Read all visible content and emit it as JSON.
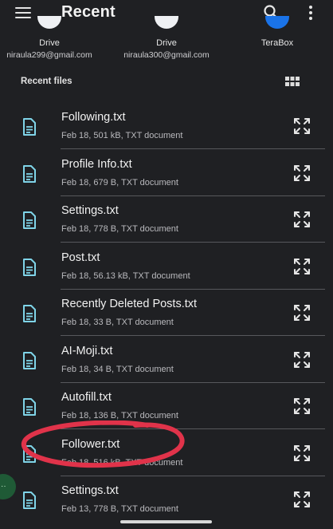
{
  "app": {
    "title": "Recent"
  },
  "roots": [
    {
      "name": "Drive",
      "email": "niraula299@gmail.com",
      "color": "#3b6fd8"
    },
    {
      "name": "Drive",
      "email": "niraula300@gmail.com",
      "color": "#3b6fd8"
    },
    {
      "name": "TeraBox",
      "email": "",
      "color": "#1a73e8"
    }
  ],
  "section": {
    "title": "Recent files"
  },
  "files": [
    {
      "name": "Following.txt",
      "meta": "Feb 18, 501 kB, TXT document"
    },
    {
      "name": "Profile Info.txt",
      "meta": "Feb 18, 679 B, TXT document"
    },
    {
      "name": "Settings.txt",
      "meta": "Feb 18, 778 B, TXT document"
    },
    {
      "name": "Post.txt",
      "meta": "Feb 18, 56.13 kB, TXT document"
    },
    {
      "name": "Recently Deleted Posts.txt",
      "meta": "Feb 18, 33 B, TXT document"
    },
    {
      "name": "AI-Moji.txt",
      "meta": "Feb 18, 34 B, TXT document"
    },
    {
      "name": "Autofill.txt",
      "meta": "Feb 18, 136 B, TXT document"
    },
    {
      "name": "Follower.txt",
      "meta": "Feb 18, 516 kB, TXT document"
    },
    {
      "name": "Settings.txt",
      "meta": "Feb 13, 778 B, TXT document"
    }
  ],
  "icons": {
    "menu": "hamburger-icon",
    "search": "search-icon",
    "more": "more-vert-icon",
    "grid": "grid-view-icon",
    "file": "text-document-icon",
    "expand": "expand-icon"
  },
  "colors": {
    "background": "#1f2023",
    "file_icon": "#7fd4e8",
    "annotation": "#e0334a",
    "text": "#f1f1f1"
  }
}
